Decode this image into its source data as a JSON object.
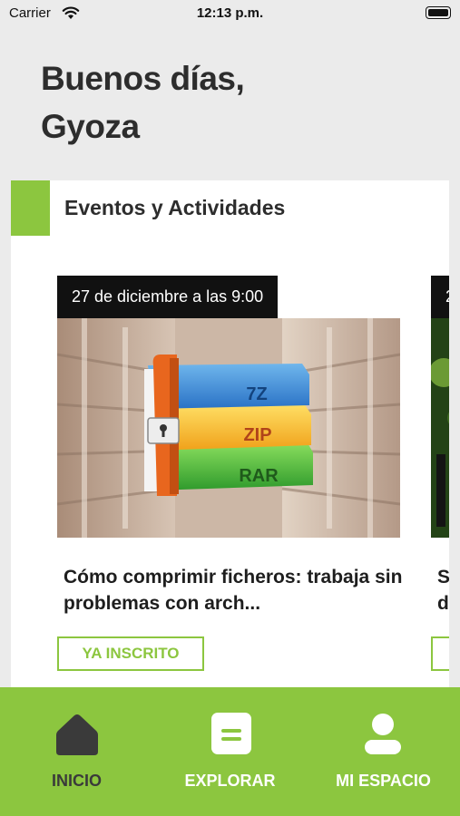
{
  "status_bar": {
    "carrier": "Carrier",
    "time": "12:13 p.m.",
    "wifi_icon": "wifi-icon",
    "battery_icon": "battery-icon"
  },
  "greeting": {
    "line1": "Buenos días,",
    "line2": "Gyoza"
  },
  "events_section": {
    "title": "Eventos y Actividades",
    "accent_color": "#8cc63f",
    "events": [
      {
        "date": "27 de diciembre a las 9:00",
        "title": "Cómo comprimir ficheros: trabaja sin problemas con arch...",
        "button_label": "YA INSCRITO",
        "image_labels": [
          "7Z",
          "ZIP",
          "RAR"
        ]
      },
      {
        "date": "2",
        "title": "S\nd",
        "button_label": ""
      }
    ]
  },
  "bottom_nav": {
    "accent_color": "#8cc63f",
    "items": [
      {
        "label": "INICIO",
        "icon": "home-icon",
        "active": true
      },
      {
        "label": "EXPLORAR",
        "icon": "explore-icon",
        "active": false
      },
      {
        "label": "MI ESPACIO",
        "icon": "user-icon",
        "active": false
      }
    ]
  }
}
